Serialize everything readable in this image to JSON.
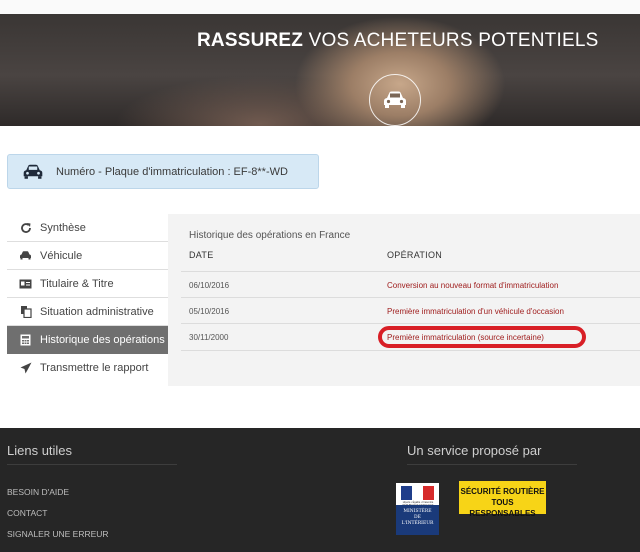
{
  "hero": {
    "title_bold": "RASSUREZ",
    "title_rest": " VOS ACHETEURS POTENTIELS",
    "icon": "car-icon"
  },
  "plate": {
    "icon": "car-icon",
    "text": "Numéro - Plaque d'immatriculation : EF-8**-WD"
  },
  "sidebar": {
    "items": [
      {
        "label": "Synthèse",
        "icon": "refresh-icon"
      },
      {
        "label": "Véhicule",
        "icon": "car-icon"
      },
      {
        "label": "Titulaire & Titre",
        "icon": "id-card-icon"
      },
      {
        "label": "Situation administrative",
        "icon": "documents-icon"
      },
      {
        "label": "Historique des opérations",
        "icon": "calculator-icon",
        "active": true
      },
      {
        "label": "Transmettre le rapport",
        "icon": "send-icon"
      }
    ]
  },
  "history": {
    "title": "Historique des opérations en France",
    "col_date": "DATE",
    "col_operation": "OPÉRATION",
    "rows": [
      {
        "date": "06/10/2016",
        "operation": "Conversion au nouveau format d'immatriculation"
      },
      {
        "date": "05/10/2016",
        "operation": "Première immatriculation d'un véhicule d'occasion"
      },
      {
        "date": "30/11/2000",
        "operation": "Première immatriculation (source incertaine)",
        "highlighted": true
      }
    ],
    "highlight_color": "#d81f26"
  },
  "footer": {
    "links_title": "Liens utiles",
    "links": [
      "BESOIN D'AIDE",
      "CONTACT",
      "SIGNALER UNE ERREUR"
    ],
    "service_title": "Un service proposé par",
    "ministry_lines": [
      "MINISTÈRE",
      "DE",
      "L'INTÉRIEUR"
    ],
    "ministry_small": "Liberté • Égalité • Fraternité RÉPUBLIQUE FRANÇAISE",
    "securite_lines": [
      "SÉCURITÉ ROUTIÈRE",
      "TOUS RESPONSABLES"
    ]
  },
  "colors": {
    "plate_bg": "#d7e9f6",
    "active_item": "#6f6f6f",
    "footer_bg": "#262626",
    "securite_yellow": "#f7d417",
    "ministry_blue": "#1a3a7a"
  }
}
